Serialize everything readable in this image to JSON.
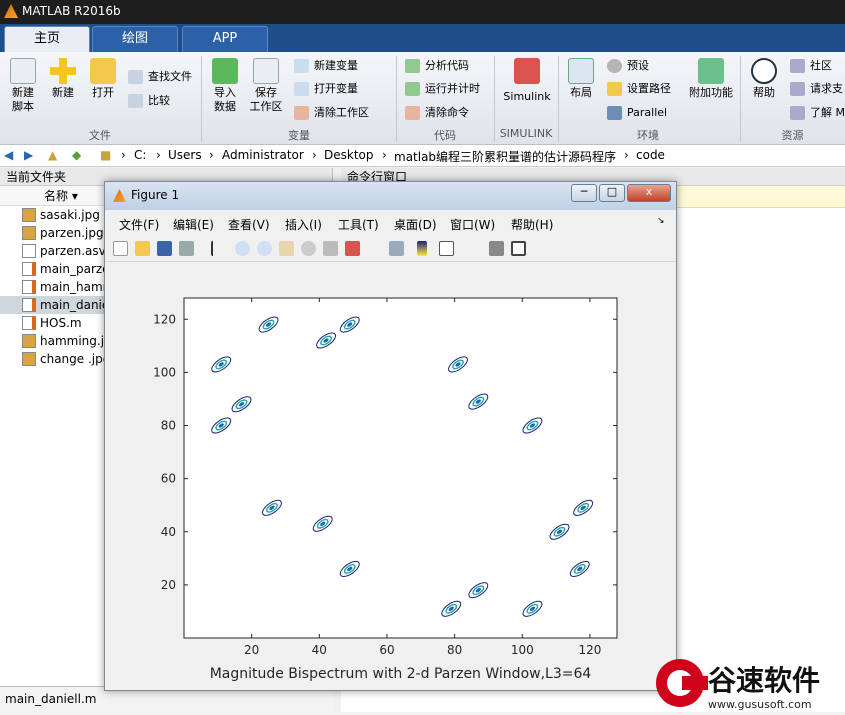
{
  "window": {
    "title": "MATLAB R2016b"
  },
  "tabs": [
    {
      "label": "主页"
    },
    {
      "label": "绘图"
    },
    {
      "label": "APP"
    }
  ],
  "ribbon": {
    "new_script": "新建\n脚本",
    "new": "新建",
    "open": "打开",
    "find_files": "查找文件",
    "compare": "比较",
    "import": "导入\n数据",
    "save_ws": "保存\n工作区",
    "new_var": "新建变量",
    "open_var": "打开变量",
    "clear_ws": "清除工作区",
    "analyze": "分析代码",
    "run_time": "运行并计时",
    "clear_cmd": "清除命令",
    "simulink": "Simulink",
    "layout": "布局",
    "prefs": "预设",
    "set_path": "设置路径",
    "parallel": "Parallel",
    "addons": "附加功能",
    "help": "帮助",
    "community": "社区",
    "request_support": "请求支",
    "learn": "了解 M",
    "groups": {
      "file": "文件",
      "variable": "变量",
      "code": "代码",
      "simulink": "SIMULINK",
      "environment": "环境",
      "resources": "资源"
    }
  },
  "address": {
    "parts": [
      "C:",
      "Users",
      "Administrator",
      "Desktop",
      "matlab编程三阶累积量谱的估计源码程序",
      "code"
    ]
  },
  "current_folder": {
    "title": "当前文件夹",
    "col_name": "名称",
    "files": [
      {
        "name": "sasaki.jpg",
        "type": "jpg"
      },
      {
        "name": "parzen.jpg",
        "type": "jpg"
      },
      {
        "name": "parzen.asv",
        "type": "asv"
      },
      {
        "name": "main_parze",
        "type": "m"
      },
      {
        "name": "main_hamm",
        "type": "m"
      },
      {
        "name": "main_danie",
        "type": "m"
      },
      {
        "name": "HOS.m",
        "type": "m"
      },
      {
        "name": "hamming.jp",
        "type": "jpg"
      },
      {
        "name": "change .jpg",
        "type": "jpg"
      }
    ],
    "footer": "main_daniell.m"
  },
  "command_window": {
    "title": "命令行窗口"
  },
  "figure": {
    "title": "Figure 1",
    "menu": [
      "文件(F)",
      "编辑(E)",
      "查看(V)",
      "插入(I)",
      "工具(T)",
      "桌面(D)",
      "窗口(W)",
      "帮助(H)"
    ],
    "min_label": "─",
    "max_label": "□",
    "close_label": "x"
  },
  "chart_data": {
    "type": "contour",
    "title": "Magnitude Bispectrum with 2-d Parzen Window,L3=64",
    "xlabel": "",
    "ylabel": "",
    "xlim": [
      0,
      128
    ],
    "ylim": [
      0,
      128
    ],
    "xticks": [
      20,
      40,
      60,
      80,
      100,
      120
    ],
    "yticks": [
      20,
      40,
      60,
      80,
      100,
      120
    ],
    "peaks": [
      {
        "x": 25,
        "y": 118
      },
      {
        "x": 42,
        "y": 112
      },
      {
        "x": 49,
        "y": 118
      },
      {
        "x": 11,
        "y": 103
      },
      {
        "x": 17,
        "y": 88
      },
      {
        "x": 11,
        "y": 80
      },
      {
        "x": 81,
        "y": 103
      },
      {
        "x": 87,
        "y": 89
      },
      {
        "x": 103,
        "y": 80
      },
      {
        "x": 26,
        "y": 49
      },
      {
        "x": 41,
        "y": 43
      },
      {
        "x": 49,
        "y": 26
      },
      {
        "x": 79,
        "y": 11
      },
      {
        "x": 87,
        "y": 18
      },
      {
        "x": 103,
        "y": 11
      },
      {
        "x": 111,
        "y": 40
      },
      {
        "x": 118,
        "y": 49
      },
      {
        "x": 117,
        "y": 26
      }
    ]
  },
  "watermark": {
    "text": "谷速软件",
    "url": "www.gususoft.com"
  },
  "colors": {
    "ribbon_blue": "#1f4f8a",
    "contour_outer": "#1a237e",
    "contour_mid": "#26a69a",
    "contour_inner": "#1565c0"
  }
}
